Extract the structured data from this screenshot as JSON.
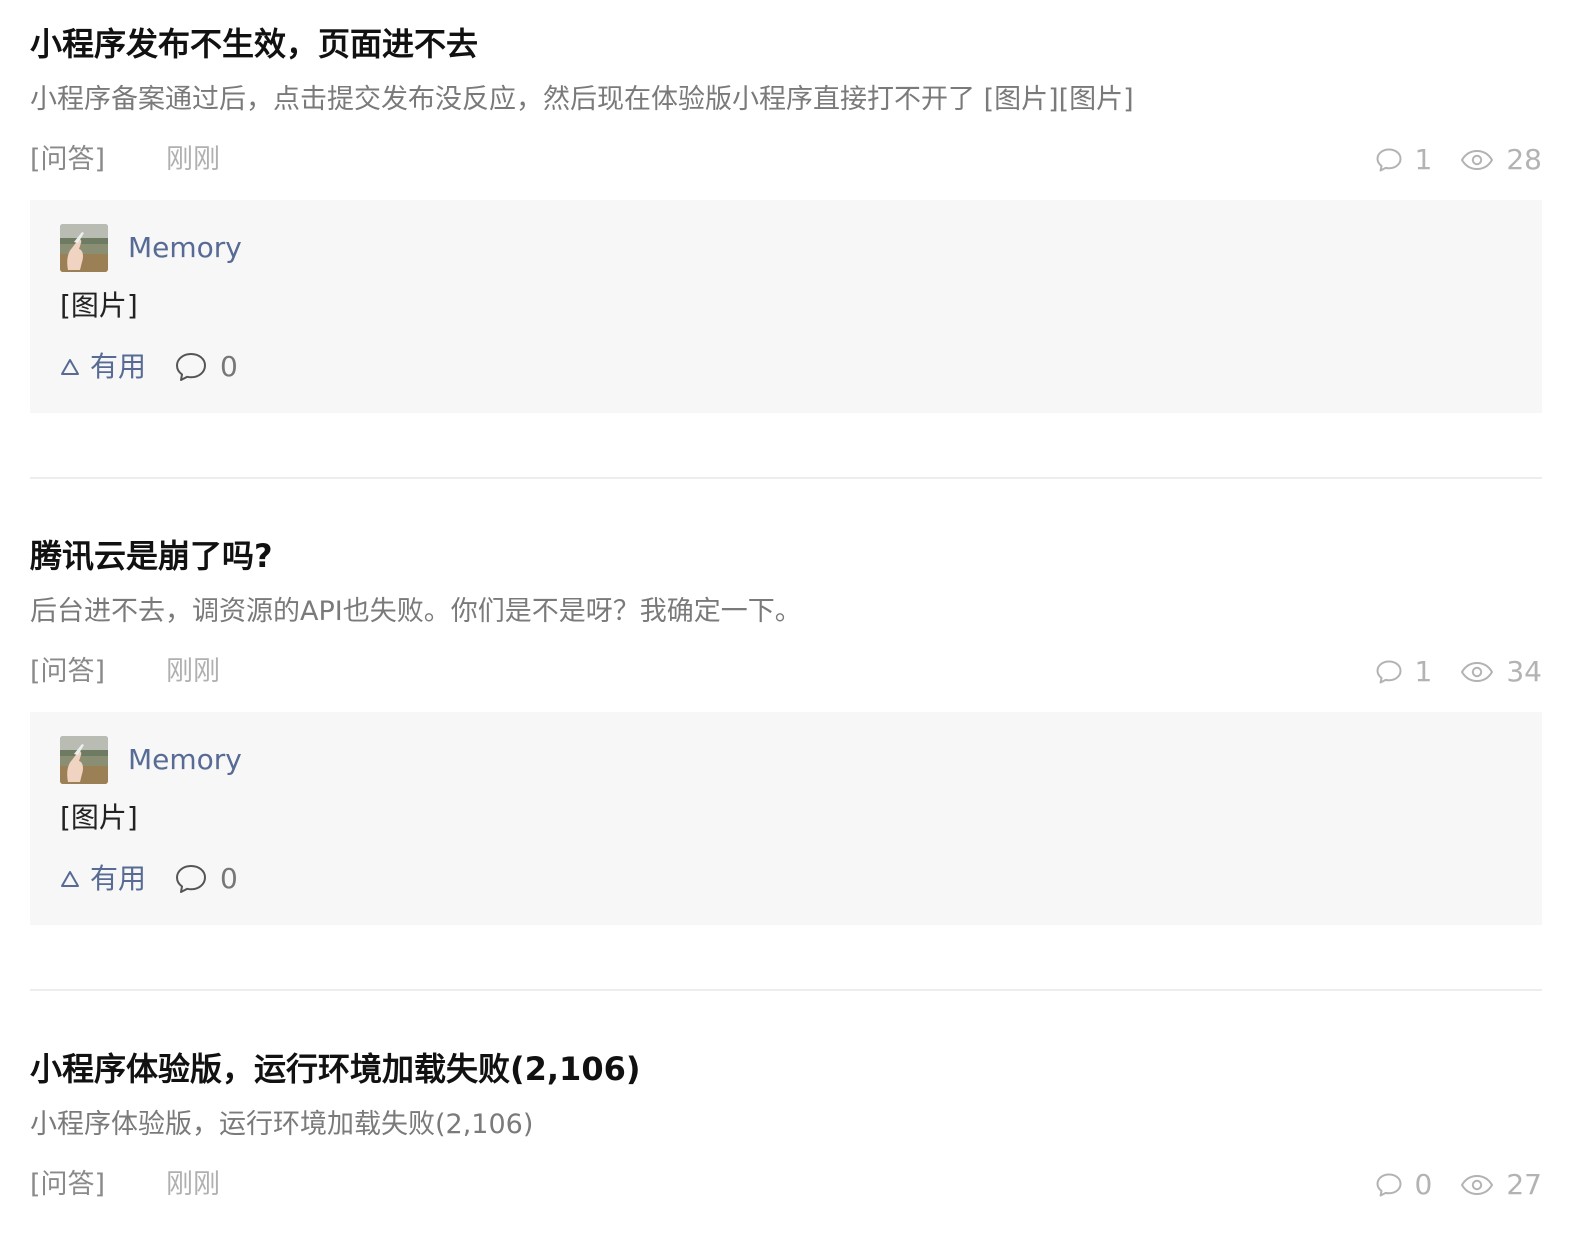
{
  "posts": [
    {
      "title": "小程序发布不生效，页面进不去",
      "excerpt": "小程序备案通过后，点击提交发布没反应，然后现在体验版小程序直接打不开了 [图片][图片]",
      "tag": "[问答]",
      "time": "刚刚",
      "comment_count": "1",
      "view_count": "28",
      "reply": {
        "author": "Memory",
        "body": "[图片]",
        "useful_label": "有用",
        "comment_count": "0"
      }
    },
    {
      "title": "腾讯云是崩了吗?",
      "excerpt": "后台进不去，调资源的API也失败。你们是不是呀？我确定一下。",
      "tag": "[问答]",
      "time": "刚刚",
      "comment_count": "1",
      "view_count": "34",
      "reply": {
        "author": "Memory",
        "body": "[图片]",
        "useful_label": "有用",
        "comment_count": "0"
      }
    },
    {
      "title": "小程序体验版，运行环境加载失败(2,106)",
      "excerpt": "小程序体验版，运行环境加载失败(2,106)",
      "tag": "[问答]",
      "time": "刚刚",
      "comment_count": "0",
      "view_count": "27"
    }
  ],
  "icons": {
    "comment": "comment-bubble-icon",
    "view": "eye-icon",
    "useful": "triangle-up-icon"
  },
  "colors": {
    "link": "#576b95",
    "muted": "#b3b3b3",
    "reply_background": "#f7f7f7"
  }
}
